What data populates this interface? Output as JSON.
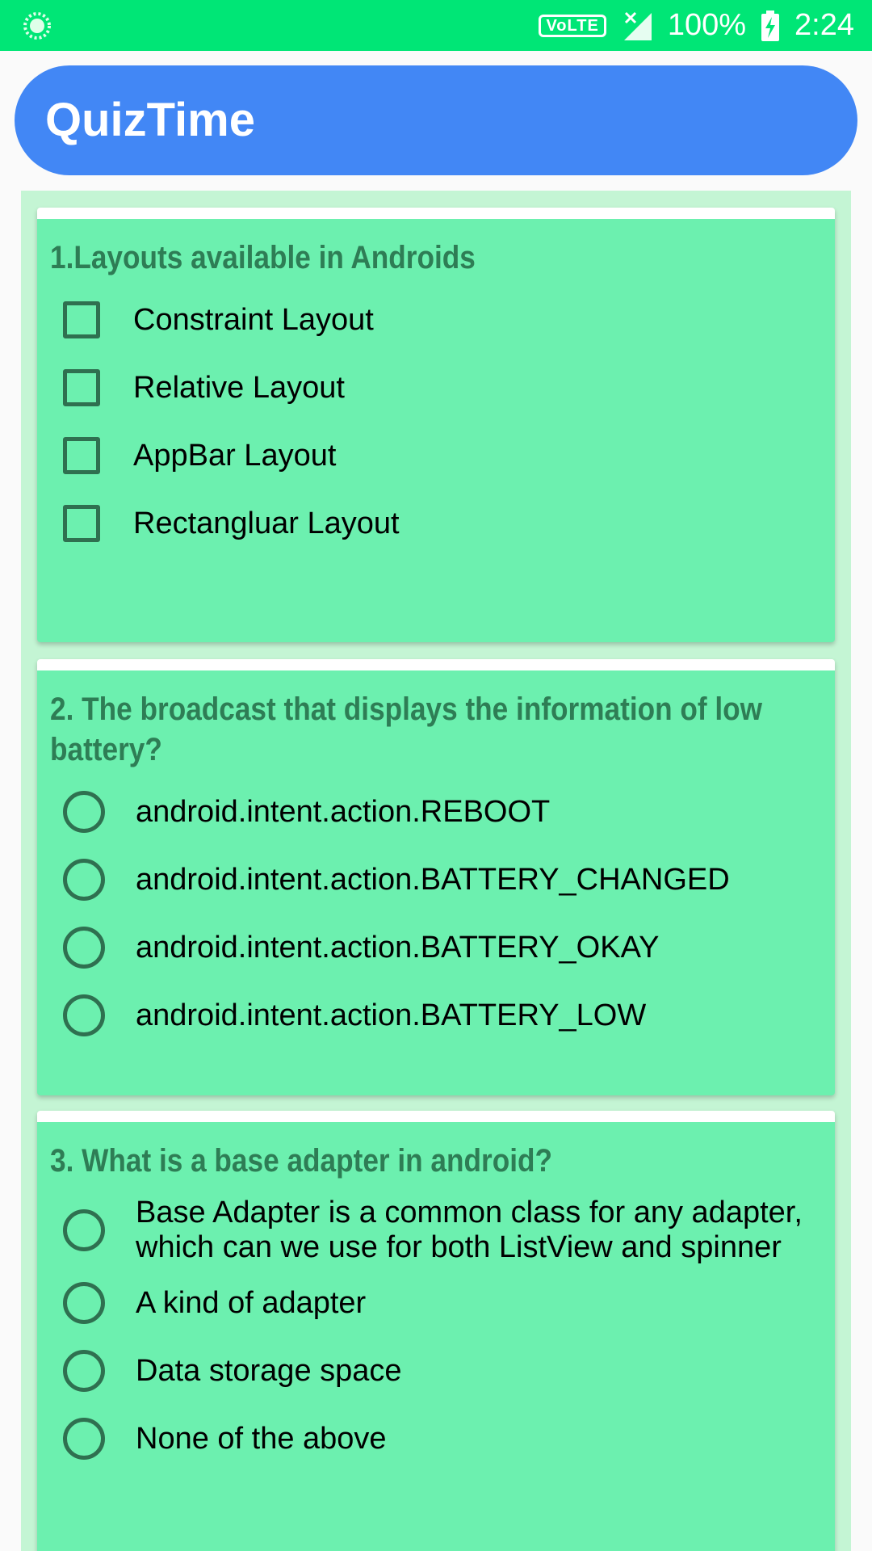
{
  "status_bar": {
    "volte": "VoLTE",
    "battery": "100%",
    "time": "2:24",
    "icons": [
      "sync-icon",
      "signal-icon",
      "battery-charging-icon"
    ]
  },
  "app_bar": {
    "title": "QuizTime"
  },
  "colors": {
    "status_bar": "#00e676",
    "app_bar": "#4287f5",
    "list_background": "#c4f5d4",
    "card_background": "#6cf0af",
    "question_text": "#2e7d55"
  },
  "questions": [
    {
      "text": "1.Layouts available in Androids",
      "type": "checkbox",
      "options": [
        "Constraint Layout",
        "Relative Layout",
        "AppBar Layout",
        "Rectangluar Layout"
      ]
    },
    {
      "text": "2. The broadcast that displays the information of low battery?",
      "type": "radio",
      "options": [
        "android.intent.action.REBOOT",
        "android.intent.action.BATTERY_CHANGED",
        "android.intent.action.BATTERY_OKAY",
        "android.intent.action.BATTERY_LOW"
      ]
    },
    {
      "text": "3. What is a base adapter in android?",
      "type": "radio",
      "options": [
        "Base Adapter is a common class for any adapter, which can we use for both ListView and spinner",
        "A kind of adapter",
        "Data storage space",
        "None of the above"
      ]
    }
  ]
}
